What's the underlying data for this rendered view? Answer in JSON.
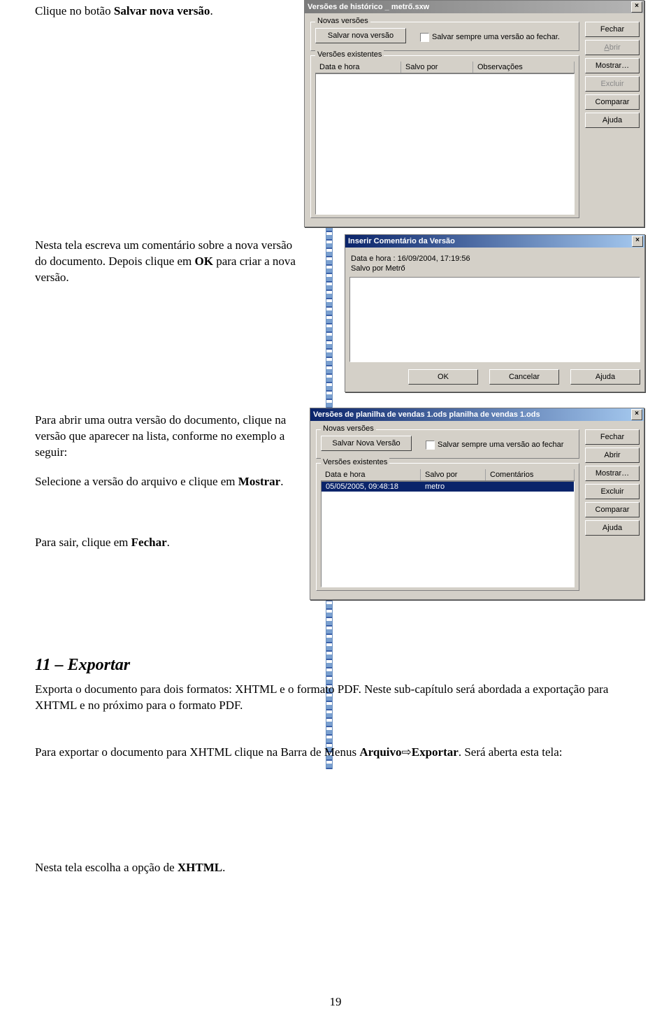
{
  "text": {
    "p1a": "Clique no botão ",
    "p1b": "Salvar nova versão",
    "p1c": ".",
    "p2a": "Nesta tela escreva um comentário sobre a nova versão do documento. Depois clique em ",
    "p2b": "OK",
    "p2c": " para criar a nova versão.",
    "p3": "Para abrir uma outra versão do documento, clique na versão que aparecer na lista, conforme no exemplo a seguir:",
    "p4a": "Selecione a versão do arquivo e clique em ",
    "p4b": "Mostrar",
    "p4c": ".",
    "p5a": "Para sair, clique em ",
    "p5b": "Fechar",
    "p5c": ".",
    "h1": "11 – Exportar",
    "p6": "Exporta o documento para dois formatos: XHTML e o formato PDF. Neste sub-capítulo será abordada a exportação para XHTML e no próximo para o formato PDF.",
    "p7a": "Para exportar o documento para XHTML clique na Barra de Menus ",
    "p7b": "Arquivo",
    "p7arrow": "⇨",
    "p7c": "Exportar",
    "p7d": ". Será aberta esta tela:",
    "p8a": "Nesta tela escolha a opção de ",
    "p8b": "XHTML",
    "p8c": ".",
    "pagenum": "19"
  },
  "dlg1": {
    "title": "Versões de histórico _ metrő.sxw",
    "grp_new": "Novas versões",
    "btn_save": "Salvar nova versão",
    "chk_label": "Salvar sempre uma versão ao fechar.",
    "grp_exist": "Versões existentes",
    "col1": "Data e hora",
    "col2": "Salvo por",
    "col3": "Observações",
    "btn_fechar": "Fechar",
    "btn_abrir": "Abrir",
    "btn_mostrar": "Mostrar…",
    "btn_excluir": "Excluir",
    "btn_comparar": "Comparar",
    "btn_ajuda": "Ajuda"
  },
  "dlg2": {
    "title": "Inserir Comentário da Versão",
    "line1": "Data e hora : 16/09/2004, 17:19:56",
    "line2": "Salvo por Metrő",
    "btn_ok": "OK",
    "btn_cancel": "Cancelar",
    "btn_help": "Ajuda"
  },
  "dlg3": {
    "title": "Versões de planilha de vendas 1.ods planilha de vendas 1.ods",
    "grp_new": "Novas versões",
    "btn_save": "Salvar Nova Versão",
    "chk_label": "Salvar sempre uma versão ao fechar",
    "grp_exist": "Versões existentes",
    "col1": "Data e hora",
    "col2": "Salvo por",
    "col3": "Comentários",
    "row_dt": "05/05/2005, 09:48:18",
    "row_user": "metro",
    "btn_fechar": "Fechar",
    "btn_abrir": "Abrir",
    "btn_mostrar": "Mostrar…",
    "btn_excluir": "Excluir",
    "btn_comparar": "Comparar",
    "btn_ajuda": "Ajuda"
  }
}
